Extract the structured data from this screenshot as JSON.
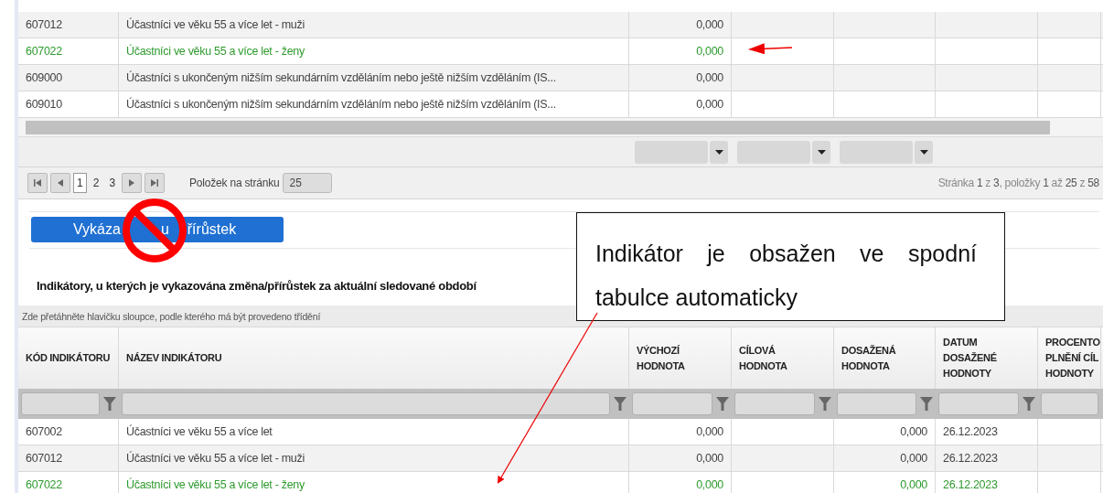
{
  "top_table": {
    "rows": [
      {
        "code": "607012",
        "name": "Účastníci ve věku 55 a více let - muži",
        "value": "0,000",
        "highlighted": false
      },
      {
        "code": "607022",
        "name": "Účastníci ve věku 55 a více let - ženy",
        "value": "0,000",
        "highlighted": true
      },
      {
        "code": "609000",
        "name": "Účastníci s ukončeným nižším sekundárním vzděláním nebo ještě nižším vzděláním (IS...",
        "value": "0,000",
        "highlighted": false
      },
      {
        "code": "609010",
        "name": "Účastníci s ukončeným nižším sekundárním vzděláním nebo ještě nižším vzděláním (IS...",
        "value": "0,000",
        "highlighted": false
      }
    ]
  },
  "pager": {
    "pages": [
      {
        "label": "1",
        "selected": true
      },
      {
        "label": "2",
        "selected": false
      },
      {
        "label": "3",
        "selected": false
      }
    ],
    "page_size_label": "Položek na stránku",
    "page_size": "25",
    "summary": "Stránka **1** z **3**, položky **1** až **25** z **58**"
  },
  "action_button": {
    "label_parts": [
      "Vykáza",
      "u",
      "řírůstek"
    ]
  },
  "section_title": "Indikátory, u kterých je vykazována změna/přírůstek za aktuální sledované období",
  "group_hint": "Zde přetáhněte hlavičku sloupce, podle kterého má být provedeno třídění",
  "bottom_table": {
    "columns": [
      "KÓD INDIKÁTORU",
      "NÁZEV INDIKÁTORU",
      "VÝCHOZÍ HODNOTA",
      "CÍLOVÁ HODNOTA",
      "DOSAŽENÁ HODNOTA",
      "DATUM DOSAŽENÉ HODNOTY",
      "PROCENTO PLNĚNÍ CÍL HODNOTY"
    ],
    "rows": [
      {
        "code": "607002",
        "name": "Účastníci ve věku 55 a více let",
        "baseline": "0,000",
        "achieved": "0,000",
        "date": "26.12.2023",
        "highlighted": false
      },
      {
        "code": "607012",
        "name": "Účastníci ve věku 55 a více let - muži",
        "baseline": "0,000",
        "achieved": "0,000",
        "date": "26.12.2023",
        "highlighted": false
      },
      {
        "code": "607022",
        "name": "Účastníci ve věku 55 a více let - ženy",
        "baseline": "0,000",
        "achieved": "0,000",
        "date": "26.12.2023",
        "highlighted": true
      }
    ]
  },
  "callout": {
    "text": "Indikátor je obsažen ve spodní tabulce automaticky"
  }
}
